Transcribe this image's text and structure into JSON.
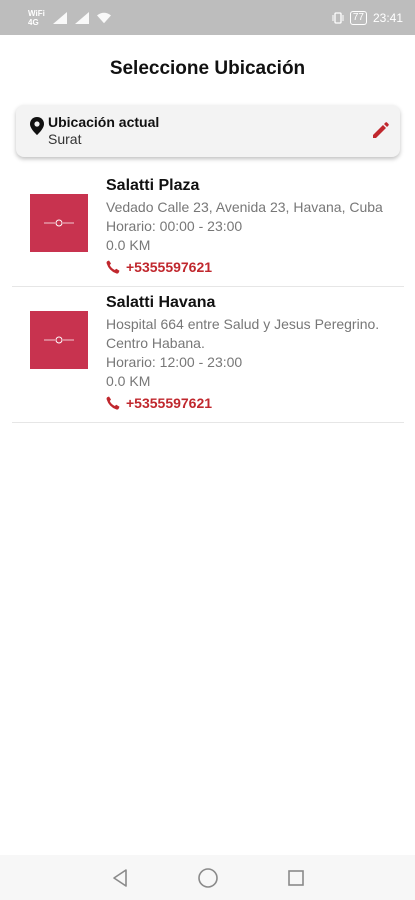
{
  "status_bar": {
    "carrier_top": "WiFi",
    "carrier_bottom": "4G",
    "battery": "77",
    "time": "23:41"
  },
  "header": {
    "title": "Seleccione Ubicación"
  },
  "current_location": {
    "label": "Ubicación actual",
    "value": "Surat",
    "icons": {
      "pin": "location-pin-icon",
      "edit": "edit-pencil-icon"
    }
  },
  "stores": [
    {
      "name": "Salatti Plaza",
      "address": "Vedado Calle 23, Avenida 23, Havana, Cuba",
      "hours": "Horario: 00:00 - 23:00",
      "distance": "0.0 KM",
      "phone": "+5355597621"
    },
    {
      "name": "Salatti Havana",
      "address": "Hospital 664 entre Salud y Jesus Peregrino. Centro Habana.",
      "hours": "Horario: 12:00 - 23:00",
      "distance": "0.0 KM",
      "phone": "+5355597621"
    }
  ],
  "colors": {
    "accent": "#c0272d",
    "thumb_bg": "#c8334f",
    "status_bar": "#bdbdbd"
  }
}
